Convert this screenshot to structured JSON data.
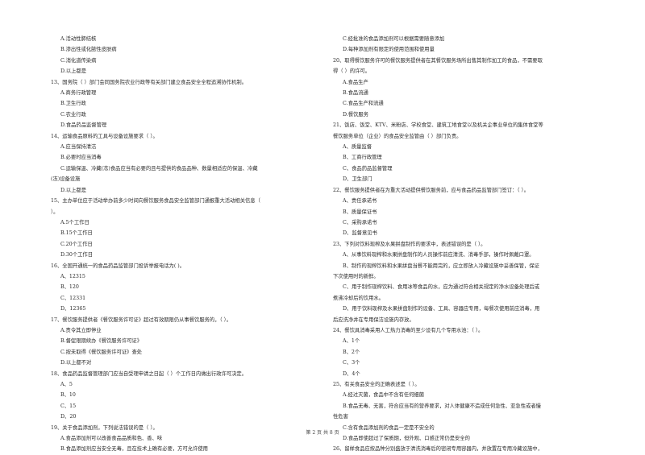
{
  "document": {
    "footer": "第 2 页 共 8 页",
    "left_column": [
      {
        "type": "option",
        "text": "A.活动性肺结核"
      },
      {
        "type": "option",
        "text": "B.渗出性或化脓性皮肤病"
      },
      {
        "type": "option",
        "text": "C.消化道传染病"
      },
      {
        "type": "option",
        "text": "D.以上都是"
      },
      {
        "type": "question",
        "text": "13、国务院（      ）部门会同国务院农业行政等有关部门建立食品安全全程追溯协作机制。"
      },
      {
        "type": "option",
        "text": "A.商务行政管理"
      },
      {
        "type": "option",
        "text": "B.卫生行政"
      },
      {
        "type": "option",
        "text": "C.农业行政"
      },
      {
        "type": "option",
        "text": "D.食品药品监督管理"
      },
      {
        "type": "question",
        "text": "14、运输食品原料的工具与设备设施要求（      ）。"
      },
      {
        "type": "option",
        "text": "A.应当保持清洁"
      },
      {
        "type": "option",
        "text": "B.必要时应当消毒"
      },
      {
        "type": "option",
        "text": "C.运输保温、冷藏(冻)食品应当有必要的且与提供的食品品种、数量相适应的保温、冷藏"
      },
      {
        "type": "continuation",
        "text": "(冻)设备设施"
      },
      {
        "type": "option",
        "text": "D.以上都是"
      },
      {
        "type": "question",
        "text": "15、主办单位应于活动举办前多少时间向餐饮服务食品安全监管部门通报重大活动相关信息（"
      },
      {
        "type": "continuation",
        "text": "）。"
      },
      {
        "type": "option",
        "text": "A.5个工作日"
      },
      {
        "type": "option",
        "text": "B.15个工作日"
      },
      {
        "type": "option",
        "text": "C.20个工作日"
      },
      {
        "type": "option",
        "text": "D.30个工作日"
      },
      {
        "type": "question",
        "text": "16、全国开通统一的食品药品监管部门投诉举报电话为(      )。"
      },
      {
        "type": "option",
        "text": "A、12315"
      },
      {
        "type": "option",
        "text": "B、120"
      },
      {
        "type": "option",
        "text": "C、12331"
      },
      {
        "type": "option",
        "text": "D、12365"
      },
      {
        "type": "question",
        "text": "17、餐饮服务提供者《餐饮服务许可证》超过有效期限仍从事餐饮服务的，（      ）。"
      },
      {
        "type": "option",
        "text": "A.责令其立即停业"
      },
      {
        "type": "option",
        "text": "B.督促限期续办《餐饮服务许可证》"
      },
      {
        "type": "option",
        "text": "C.按未取得《餐饮服务许可证》查处"
      },
      {
        "type": "option",
        "text": "D.以上都不对"
      },
      {
        "type": "question",
        "text": "18、食品药品监督管理部门应当自受理申请之日起（      ）个工作日内做出行政许可决定。"
      },
      {
        "type": "option",
        "text": "A、5"
      },
      {
        "type": "option",
        "text": "B、10"
      },
      {
        "type": "option",
        "text": "C、15"
      },
      {
        "type": "option",
        "text": "D、20"
      },
      {
        "type": "question",
        "text": "19、关于食品添加剂，下列说法错误的是（      ）。"
      },
      {
        "type": "option",
        "text": "A.食品添加剂可以改善食品品质和色、香、味"
      },
      {
        "type": "option",
        "text": "B.食品添加剂应当安全无毒，且在技术上确有必要，方可允许使用"
      }
    ],
    "right_column": [
      {
        "type": "option",
        "text": "C.经批准的食品添加剂可以根据需要随意添加"
      },
      {
        "type": "option",
        "text": "D.每种添加剂有限定的使用范围和使用量"
      },
      {
        "type": "question",
        "text": "20、取得餐饮服务许可的餐饮服务提供者在其餐饮服务场所出售其制作加工的食品，不需要取"
      },
      {
        "type": "continuation",
        "text": "得（      ）的许可。"
      },
      {
        "type": "option",
        "text": "A.食品生产"
      },
      {
        "type": "option",
        "text": "B.食品流通"
      },
      {
        "type": "option",
        "text": "C.食品生产和流通"
      },
      {
        "type": "option",
        "text": "D.餐饮服务"
      },
      {
        "type": "question",
        "text": "21、饭店、饭堂、KTV、米粉店、学校食堂、建筑工地食堂以及机关企事业单位的集体食堂等"
      },
      {
        "type": "continuation",
        "text": "餐饮服务单位（企业）的食品安全监管由（      ）部门负责。"
      },
      {
        "type": "option",
        "text": "A、质量监督"
      },
      {
        "type": "option",
        "text": "B、工商行政管理"
      },
      {
        "type": "option",
        "text": "C、食品药品监督管理"
      },
      {
        "type": "option",
        "text": "D、卫生部门"
      },
      {
        "type": "question",
        "text": "22、餐饮服务提供者在为重大活动提供餐饮服务前，应与食品药品监管部门签订：（      ）。"
      },
      {
        "type": "option",
        "text": "A、责任承诺书"
      },
      {
        "type": "option",
        "text": "B、质量保证书"
      },
      {
        "type": "option",
        "text": "C、采购承诺书"
      },
      {
        "type": "option",
        "text": "D、监督意见书"
      },
      {
        "type": "question",
        "text": "23、下列对饮料现榨及水果拼盘制作的要求中，表述错误的是（    ）。"
      },
      {
        "type": "option",
        "text": "A、从事饮料现榨和水果拼盘制作的人员操作前应清洗、消毒手部，操作时佩戴口罩。"
      },
      {
        "type": "option",
        "text": "B、制作的现榨饮料和水果拼盘当餐不能用完的，应立即放入冷藏设施中妥善保管，保证"
      },
      {
        "type": "continuation",
        "text": "下次使用时的新鲜。"
      },
      {
        "type": "option",
        "text": "C、用于制作现榨饮料、食用冰等食品的水，应为通过符合相关规定的净水设备处理后或"
      },
      {
        "type": "continuation",
        "text": "煮沸冷却后的饮用水。"
      },
      {
        "type": "option",
        "text": "D、用于饮料现榨及水果拼盘制作的设备、工具、容器应专用，每餐次使用前应消毒，用"
      },
      {
        "type": "continuation",
        "text": "后应洗净并在专用保洁设施内存放。"
      },
      {
        "type": "question",
        "text": "24、餐饮具消毒采用人工热力消毒的至少设有几个专用水池：（      ）。"
      },
      {
        "type": "option",
        "text": "A、1个"
      },
      {
        "type": "option",
        "text": "B、2个"
      },
      {
        "type": "option",
        "text": "C、3个"
      },
      {
        "type": "option",
        "text": "D、4个"
      },
      {
        "type": "question",
        "text": "25、有关食品安全的正确表述是（      ）。"
      },
      {
        "type": "option",
        "text": "A.经过灭菌，食品中不含有任何细菌"
      },
      {
        "type": "option",
        "text": "B.食品无毒、无害，符合应当有的营养要求，对人体健康不造成任何急性、亚急性或者慢"
      },
      {
        "type": "continuation",
        "text": "性危害"
      },
      {
        "type": "option",
        "text": "C.含有食品添加剂的食品一定是不安全的"
      },
      {
        "type": "option",
        "text": "D.食品即使超过了保质期，但外观、口感正常仍是安全的"
      },
      {
        "type": "question",
        "text": "26、留样食品应按品种分别盛放于清洗消毒后的密闭专用容器内，并放置在专用冷藏设施中，"
      }
    ]
  }
}
